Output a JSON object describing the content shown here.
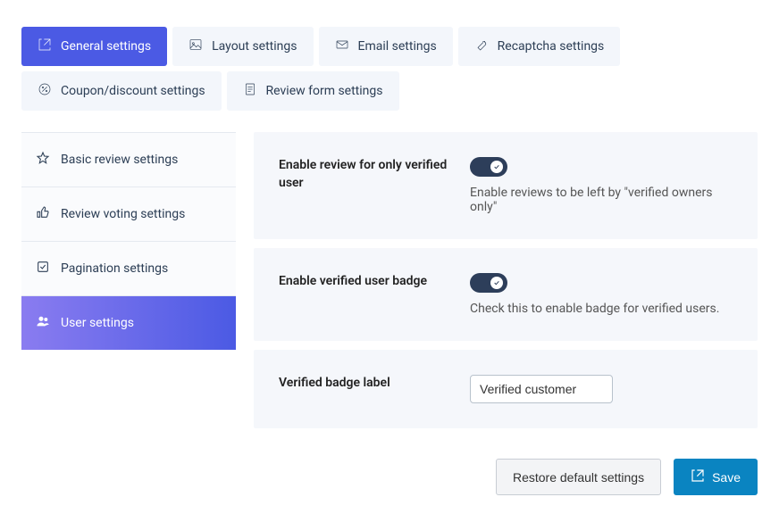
{
  "tabs": [
    {
      "id": "general",
      "label": "General settings",
      "active": true
    },
    {
      "id": "layout",
      "label": "Layout settings",
      "active": false
    },
    {
      "id": "email",
      "label": "Email settings",
      "active": false
    },
    {
      "id": "recaptcha",
      "label": "Recaptcha settings",
      "active": false
    },
    {
      "id": "coupon",
      "label": "Coupon/discount settings",
      "active": false
    },
    {
      "id": "reviewform",
      "label": "Review form settings",
      "active": false
    }
  ],
  "sidebar": [
    {
      "id": "basic",
      "label": "Basic review settings",
      "active": false
    },
    {
      "id": "voting",
      "label": "Review voting settings",
      "active": false
    },
    {
      "id": "pagination",
      "label": "Pagination settings",
      "active": false
    },
    {
      "id": "user",
      "label": "User settings",
      "active": true
    }
  ],
  "panels": {
    "verified_only": {
      "label": "Enable review for only verified user",
      "help": "Enable reviews to be left by \"verified owners only\"",
      "value": true
    },
    "verified_badge": {
      "label": "Enable verified user badge",
      "help": "Check this to enable badge for verified users.",
      "value": true
    },
    "badge_label": {
      "label": "Verified badge label",
      "value": "Verified customer"
    }
  },
  "footer": {
    "restore": "Restore default settings",
    "save": "Save"
  }
}
